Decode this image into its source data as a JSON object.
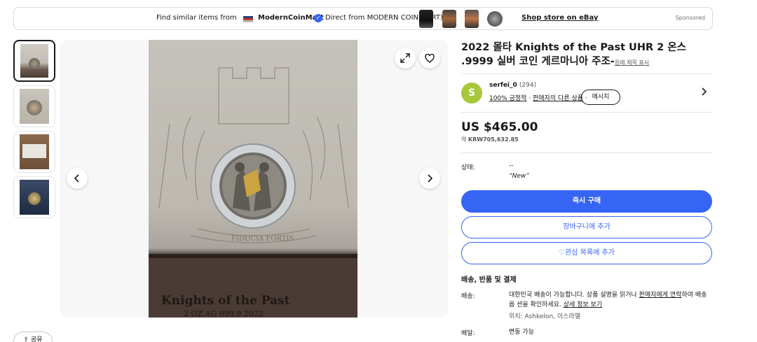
{
  "banner": {
    "find_text": "Find similar items from",
    "store_name": "ModernCoinMart",
    "direct_text": "Direct from MODERN COIN MART)",
    "shop_link": "Shop store on eBay",
    "sponsored": "Sponsored"
  },
  "gallery": {
    "thumbnail_count": 4,
    "prev_icon": "chevron-left-icon",
    "next_icon": "chevron-right-icon",
    "expand_icon": "expand-icon",
    "heart_icon": "heart-icon",
    "photo_text": "Knights of the Past",
    "photo_text_2": "2 OZ AG 999.9 2022",
    "photo_text_3": "FIDUCIA FORTIS"
  },
  "share_label": "공유",
  "listing": {
    "title": "2022 몰타 Knights of the Past UHR 2 온스 .9999 실버 코인 게르마니아 주조-",
    "original_title_link": "원래 제목 표시"
  },
  "seller": {
    "initial": "S",
    "name": "serfei_0",
    "feedback_count": "(294)",
    "positive": "100% 긍정적",
    "separator": "·",
    "other_items": "판매자의 다른 상품",
    "message_button": "메시지"
  },
  "price": {
    "main": "US $465.00",
    "approx_prefix": "약",
    "approx_value": "KRW705,632.85"
  },
  "condition": {
    "label": "상태:",
    "value": "--",
    "quote": "“New”"
  },
  "actions": {
    "buy_now": "즉시 구매",
    "add_to_cart": "장바구니에 추가",
    "watchlist": "관심 목록에 추가"
  },
  "shipping": {
    "section_title": "배송, 반품 및 결제",
    "shipping_label": "배송:",
    "shipping_text_1": "대한민국 배송이 가능합니다. 상품 설명을 읽거나",
    "contact_seller": "판매자에게 연락",
    "shipping_text_2": "하여 배송 옵",
    "shipping_text_3": "션을 확인하세요.",
    "see_details": "상세 정보 보기",
    "location": "위치: Ashkelon, 이스라엘",
    "delivery_label": "배달:",
    "delivery_value": "변동 가능"
  },
  "colors": {
    "accent": "#3665f3",
    "avatar": "#a8c73a"
  }
}
